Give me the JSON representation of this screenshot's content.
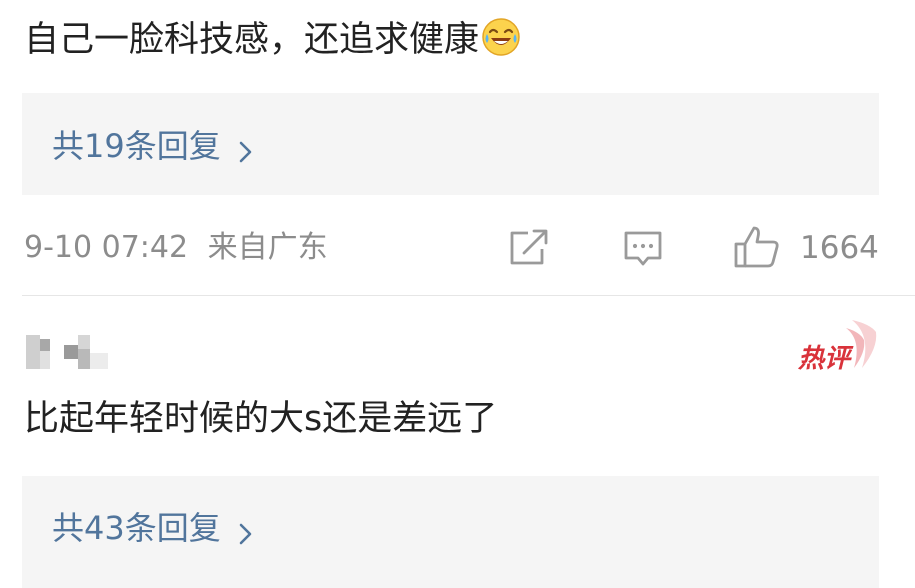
{
  "comments": [
    {
      "text": "自己一脸科技感，还追求健康",
      "emoji": "laughing-crying-icon",
      "replies_label": "共19条回复",
      "timestamp": "9-10 07:42",
      "location": "来自广东",
      "like_count": "1664"
    },
    {
      "username": "",
      "badge": "热评",
      "text": "比起年轻时候的大s还是差远了",
      "replies_label": "共43条回复"
    }
  ],
  "icons": {
    "share": "share-edit-icon",
    "comment": "comment-bubble-icon",
    "like": "thumbs-up-icon",
    "chevron": "chevron-right-icon"
  },
  "colors": {
    "text": "#222222",
    "link": "#51759c",
    "meta": "#8c8c8c",
    "reply_bg": "#f5f5f5",
    "badge": "#d9323a"
  }
}
